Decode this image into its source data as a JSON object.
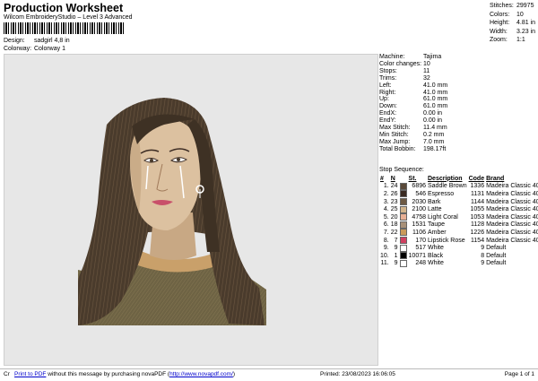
{
  "header": {
    "title": "Production Worksheet",
    "subtitle": "Wilcom EmbroideryStudio – Level 3 Advanced"
  },
  "meta": [
    {
      "label": "Design:",
      "value": "sadgirl 4,8 in"
    },
    {
      "label": "Colorway:",
      "value": "Colorway 1"
    }
  ],
  "stats": [
    {
      "label": "Stitches:",
      "value": "29975"
    },
    {
      "label": "Colors:",
      "value": "10"
    },
    {
      "label": "Height:",
      "value": "4.81 in"
    },
    {
      "label": "Width:",
      "value": "3.23 in"
    },
    {
      "label": "Zoom:",
      "value": "1:1"
    }
  ],
  "properties": [
    {
      "label": "Machine:",
      "value": "Tajima"
    },
    {
      "label": "Color changes:",
      "value": "10"
    },
    {
      "label": "Stops:",
      "value": "11"
    },
    {
      "label": "Trims:",
      "value": "32"
    },
    {
      "label": "Left:",
      "value": "41.0 mm"
    },
    {
      "label": "Right:",
      "value": "41.0 mm"
    },
    {
      "label": "Up:",
      "value": "61.0 mm"
    },
    {
      "label": "Down:",
      "value": "61.0 mm"
    },
    {
      "label": "EndX:",
      "value": "0.00 in"
    },
    {
      "label": "EndY:",
      "value": "0.00 in"
    },
    {
      "label": "Max Stitch:",
      "value": "11.4 mm"
    },
    {
      "label": "Min Stitch:",
      "value": "0.2 mm"
    },
    {
      "label": "Max Jump:",
      "value": "7.0 mm"
    },
    {
      "label": "Total Bobbin:",
      "value": "198.17ft"
    }
  ],
  "sequence": {
    "heading": "Stop Sequence:",
    "columns": [
      "#",
      "N",
      "St.",
      "Description",
      "Code",
      "Brand"
    ],
    "rows": [
      {
        "num": "1.",
        "n": "24",
        "color": "#5a4a3a",
        "st": "6896",
        "desc": "Saddle Brown",
        "code": "1336",
        "brand": "Madeira Classic 40"
      },
      {
        "num": "2.",
        "n": "26",
        "color": "#3a2a22",
        "st": "546",
        "desc": "Espresso",
        "code": "1131",
        "brand": "Madeira Classic 40"
      },
      {
        "num": "3.",
        "n": "23",
        "color": "#6e5a44",
        "st": "2030",
        "desc": "Bark",
        "code": "1144",
        "brand": "Madeira Classic 40"
      },
      {
        "num": "4.",
        "n": "25",
        "color": "#d2b48c",
        "st": "2100",
        "desc": "Latte",
        "code": "1055",
        "brand": "Madeira Classic 40"
      },
      {
        "num": "5.",
        "n": "20",
        "color": "#e8b095",
        "st": "4758",
        "desc": "Light Coral",
        "code": "1053",
        "brand": "Madeira Classic 40"
      },
      {
        "num": "6.",
        "n": "18",
        "color": "#a89078",
        "st": "1531",
        "desc": "Taupe",
        "code": "1128",
        "brand": "Madeira Classic 40"
      },
      {
        "num": "7.",
        "n": "22",
        "color": "#c99a5a",
        "st": "1106",
        "desc": "Amber",
        "code": "1226",
        "brand": "Madeira Classic 40"
      },
      {
        "num": "8.",
        "n": "7",
        "color": "#d04060",
        "st": "170",
        "desc": "Lipstick Rose",
        "code": "1154",
        "brand": "Madeira Classic 40"
      },
      {
        "num": "9.",
        "n": "9",
        "color": "#ffffff",
        "st": "517",
        "desc": "White",
        "code": "9",
        "brand": "Default"
      },
      {
        "num": "10.",
        "n": "1",
        "color": "#000000",
        "st": "10071",
        "desc": "Black",
        "code": "8",
        "brand": "Default"
      },
      {
        "num": "11.",
        "n": "9",
        "color": "#ffffff",
        "st": "248",
        "desc": "White",
        "code": "9",
        "brand": "Default"
      }
    ]
  },
  "footer": {
    "corner": "Cr",
    "link1": "Print to PDF",
    "msg": " without this message by purchasing novaPDF (",
    "link2": "http://www.novapdf.com/",
    "msg_end": ")",
    "printed": "Printed: 23/08/2023 16:06:05",
    "page": "Page 1 of 1"
  }
}
